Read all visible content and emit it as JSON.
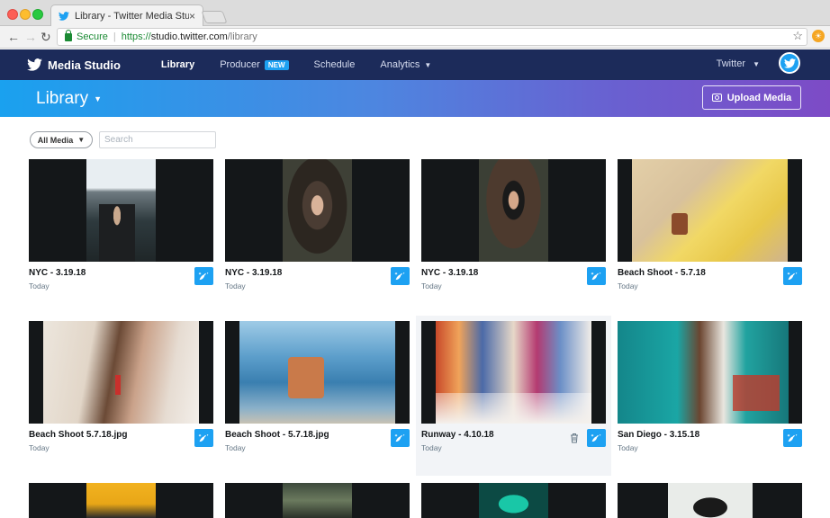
{
  "browser": {
    "tab_title": "Library - Twitter Media Studio",
    "tab_close": "×",
    "secure_label": "Secure",
    "url_proto": "https://",
    "url_host": "studio.twitter.com",
    "url_path": "/library"
  },
  "nav": {
    "brand": "Media Studio",
    "items": [
      {
        "label": "Library",
        "active": true
      },
      {
        "label": "Producer",
        "badge": "NEW"
      },
      {
        "label": "Schedule"
      },
      {
        "label": "Analytics"
      }
    ],
    "account": "Twitter"
  },
  "banner": {
    "title": "Library",
    "upload_label": "Upload Media"
  },
  "filters": {
    "media_filter": "All Media",
    "search_placeholder": "Search"
  },
  "colors": {
    "nav_bg": "#1c2b5a",
    "accent": "#1da1f2",
    "gradient_start": "#1aa1ef",
    "gradient_end": "#7d4bc6"
  },
  "media": [
    {
      "title": "NYC - 3.19.18",
      "date": "Today"
    },
    {
      "title": "NYC - 3.19.18",
      "date": "Today"
    },
    {
      "title": "NYC - 3.19.18",
      "date": "Today"
    },
    {
      "title": "Beach Shoot - 5.7.18",
      "date": "Today"
    },
    {
      "title": "Beach Shoot 5.7.18.jpg",
      "date": "Today"
    },
    {
      "title": "Beach Shoot - 5.7.18.jpg",
      "date": "Today"
    },
    {
      "title": "Runway - 4.10.18",
      "date": "Today"
    },
    {
      "title": "San Diego - 3.15.18",
      "date": "Today"
    }
  ]
}
